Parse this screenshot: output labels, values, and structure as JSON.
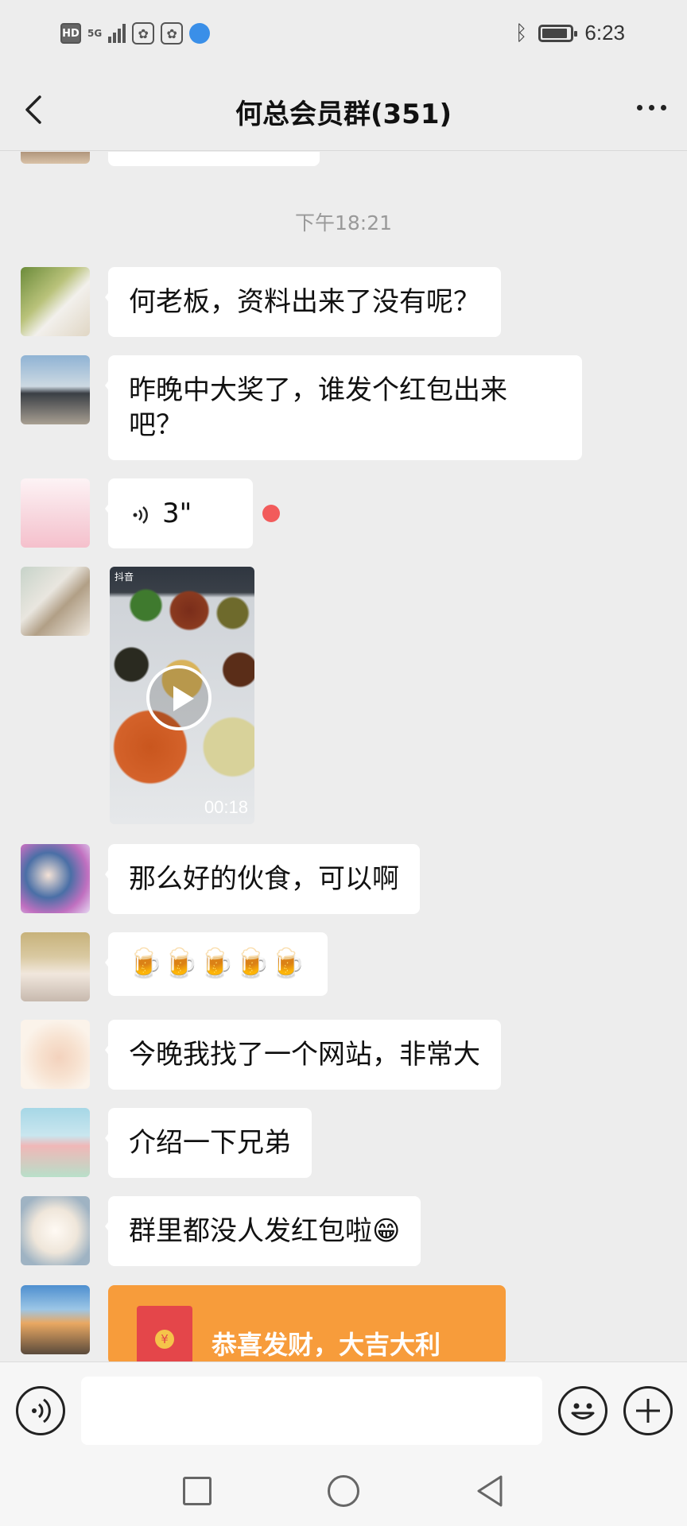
{
  "status_bar": {
    "hd": "HD",
    "network": "5G",
    "time": "6:23",
    "battery_level": 0.9
  },
  "header": {
    "title": "何总会员群(351)"
  },
  "chat": {
    "time_divider": "下午18:21",
    "messages": [
      {
        "type": "text",
        "text": "何老板，资料出来了没有呢？"
      },
      {
        "type": "text",
        "lines": [
          "昨晚中大奖了，谁发个红包出来",
          "吧？"
        ]
      },
      {
        "type": "voice",
        "duration": "3\"",
        "unread": true
      },
      {
        "type": "video",
        "duration": "00:18",
        "app": "抖音"
      },
      {
        "type": "text",
        "text": "那么好的伙食，可以啊"
      },
      {
        "type": "emoji",
        "text": "🍺🍺🍺🍺🍺"
      },
      {
        "type": "text",
        "text": "今晚我找了一个网站，非常大"
      },
      {
        "type": "text",
        "text": "介绍一下兄弟"
      },
      {
        "type": "text",
        "text": "群里都没人发红包啦😁"
      },
      {
        "type": "red_packet",
        "text": "恭喜发财，大吉大利"
      }
    ]
  },
  "input_bar": {
    "placeholder": ""
  },
  "colors": {
    "background": "#ededed",
    "bubble": "#ffffff",
    "red_packet": "#f79c3b",
    "unread_dot": "#f25b5b"
  }
}
